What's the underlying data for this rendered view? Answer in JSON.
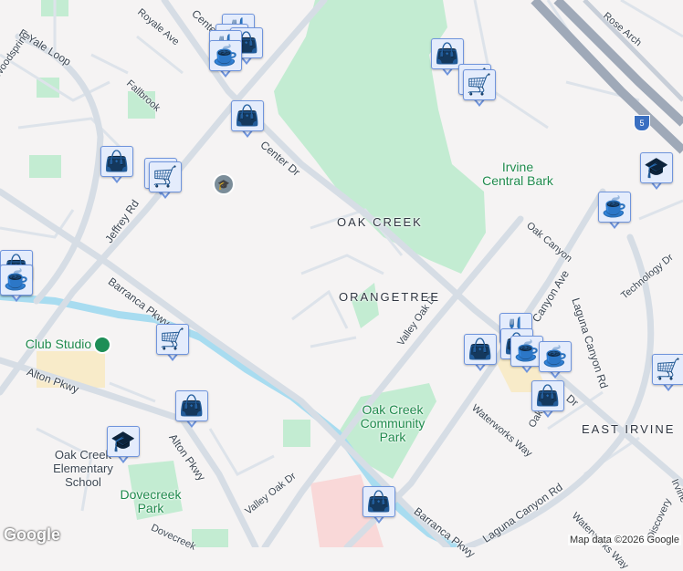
{
  "map": {
    "colors": {
      "background": "#f5f3f3",
      "park": "#c3ecd2",
      "road": "#d9dfe6",
      "water": "#a8dcf0",
      "marker_fill": "#e4ecfc",
      "marker_border": "#6f94dc",
      "marker_icon": "#02466d"
    },
    "street_labels": [
      "Center Dr",
      "Royale Ave",
      "E Yale Loop",
      "Woodspring",
      "Fallbrook",
      "Center Dr",
      "Jeffrey Rd",
      "Barranca Pkwy",
      "Barranca Pkwy",
      "Alton Pkwy",
      "Alton Pkwy",
      "Valley Oak Dr",
      "Valley Oak Dr",
      "Dovecreek",
      "Oak Canyon",
      "Laguna Canyon Rd",
      "Canyon Ave",
      "Technology Dr",
      "Rose Arch",
      "Waterworks Way",
      "Laguna Canyon Rd",
      "Waterworks Way",
      "Discovery",
      "Irvine Center Dr",
      "Oak",
      "Dr"
    ],
    "area_labels": [
      "OAK CREEK",
      "ORANGETREE",
      "EAST IRVINE"
    ],
    "place_labels": {
      "irvine_central_bark": "Irvine Central Bark",
      "oak_creek_park": "Oak Creek Community Park",
      "club_studio": "Club Studio",
      "oak_creek_school": "Oak Creek Elementary School",
      "dovecreek_park": "Dovecreek Park"
    },
    "highway_shield": "5",
    "attribution": "Map data ©2026 Google",
    "logo": "Google",
    "markers": [
      "restaurant",
      "restaurant",
      "shopping",
      "restaurant",
      "cafe",
      "shopping",
      "shopping",
      "grocery",
      "grocery",
      "shopping",
      "shopping",
      "shopping",
      "school",
      "cafe",
      "cafe",
      "grocery",
      "grocery",
      "grocery",
      "shopping",
      "school",
      "shopping",
      "shopping",
      "restaurant",
      "shopping",
      "cafe",
      "cafe",
      "shopping",
      "grocery"
    ]
  }
}
